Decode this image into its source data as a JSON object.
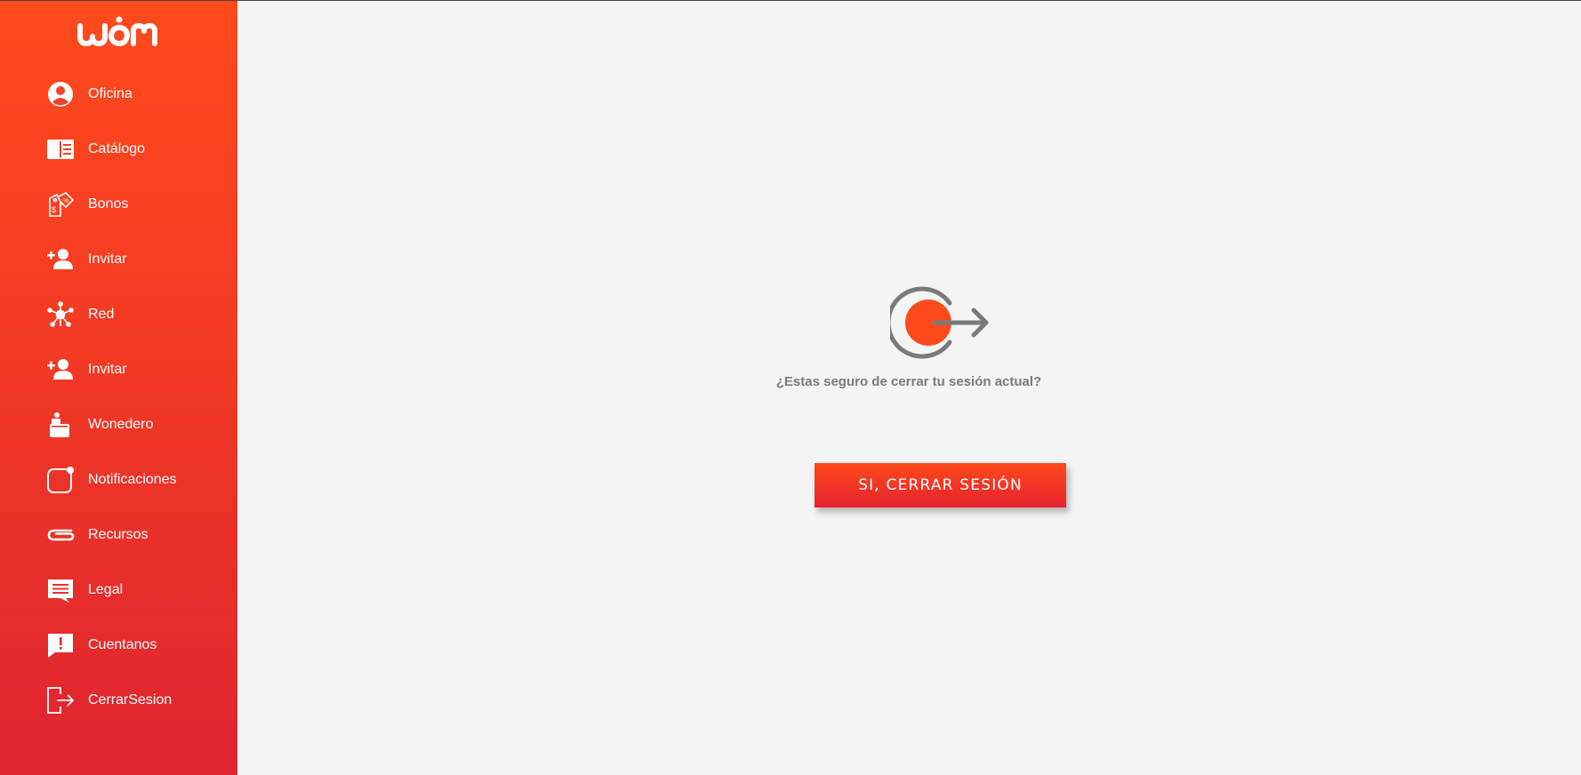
{
  "brand": {
    "logo_text": "wom",
    "accent_color": "#ff4a1c",
    "accent_color_dark": "#e5222f"
  },
  "sidebar": {
    "items": [
      {
        "label": "Oficina",
        "icon": "user-circle-icon"
      },
      {
        "label": "Catálogo",
        "icon": "catalog-book-icon"
      },
      {
        "label": "Bonos",
        "icon": "bonus-tags-icon"
      },
      {
        "label": "Invitar",
        "icon": "add-user-icon"
      },
      {
        "label": "Red",
        "icon": "network-icon"
      },
      {
        "label": "Invitar",
        "icon": "add-user-icon"
      },
      {
        "label": "Wonedero",
        "icon": "wallet-icon"
      },
      {
        "label": "Notificaciones",
        "icon": "notification-icon"
      },
      {
        "label": "Recursos",
        "icon": "paperclip-icon"
      },
      {
        "label": "Legal",
        "icon": "document-chat-icon"
      },
      {
        "label": "Cuentanos",
        "icon": "feedback-alert-icon"
      },
      {
        "label": "CerrarSesion",
        "icon": "logout-icon"
      }
    ]
  },
  "logout_panel": {
    "icon": "logout-power-icon",
    "question": "¿Estas seguro de cerrar tu sesión actual?",
    "confirm_label": "SI, CERRAR SESIÓN"
  }
}
